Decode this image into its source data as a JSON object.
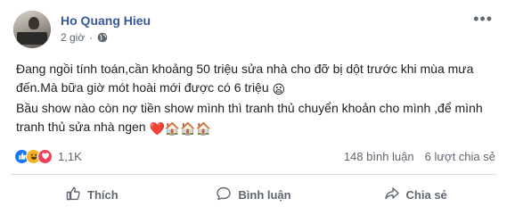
{
  "post": {
    "author": "Ho Quang Hieu",
    "time": "2 giờ",
    "separator": "·",
    "more_label": "•••",
    "text_line1": "Đang ngồi tính toán,cần khoảng 50 triệu sửa nhà cho đỡ bị dột trước khi mùa mưa đến.Mà bữa giờ mót hoài mới được có 6 triệu",
    "text_line2": "Bầu show nào còn nợ tiền show mình thì tranh thủ chuyển khoản cho mình ,để mình tranh thủ sửa nhà ngen",
    "emoji_sad": "😦",
    "emoji_heart": "❤️",
    "emoji_houses": "🏠🏠🏠"
  },
  "stats": {
    "reaction_count": "1,1K",
    "comments": "148 bình luận",
    "shares": "6 lượt chia sẻ",
    "reaction_icons": [
      "like-icon",
      "haha-icon",
      "love-icon"
    ]
  },
  "actions": {
    "like_label": "Thích",
    "comment_label": "Bình luận",
    "share_label": "Chia sẻ"
  },
  "colors": {
    "author": "#385898",
    "muted": "#606770",
    "like": "#1877f2",
    "haha": "#f7b125",
    "love": "#f33e58",
    "divider": "#dadde1"
  }
}
